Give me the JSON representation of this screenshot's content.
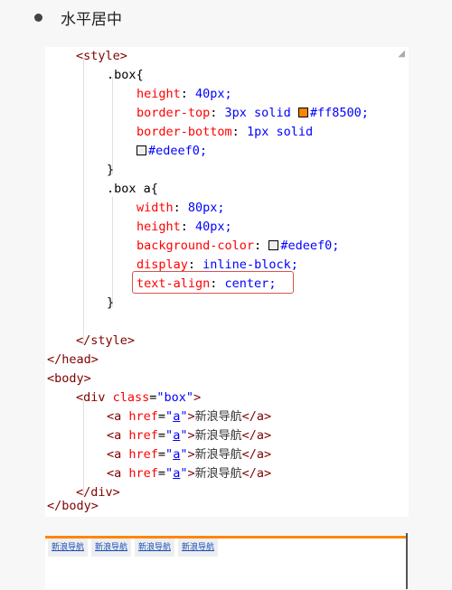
{
  "heading": {
    "text": "水平居中"
  },
  "code": {
    "l1": "<style>",
    "l2": ".box{",
    "l3_prop": "height",
    "l3_val": "40px;",
    "l4_prop": "border-top",
    "l4_val": "3px solid",
    "l4_color": "#ff8500;",
    "l5_prop": "border-bottom",
    "l5_val": "1px solid",
    "l6_color": "#edeef0;",
    "l7": "}",
    "l8": ".box a{",
    "l9_prop": "width",
    "l9_val": "80px;",
    "l10_prop": "height",
    "l10_val": "40px;",
    "l11_prop": "background-color",
    "l11_color": "#edeef0;",
    "l12_prop": "display",
    "l12_val": "inline-block;",
    "l13_prop": "text-align",
    "l13_val": "center;",
    "l14": "}",
    "l15": "</style>",
    "l16": "</head>",
    "l17": "<body>",
    "l18_open": "<div ",
    "l18_attr": "class",
    "l18_eq": "=",
    "l18_str": "\"box\"",
    "l18_close": ">",
    "link_open": "<a ",
    "link_attr": "href",
    "link_eq": "=",
    "link_str_q1": "\"",
    "link_str_a": "a",
    "link_str_q2": "\"",
    "link_gt": ">",
    "link_text": "新浪导航",
    "link_close": "</a>",
    "l23": "</div>",
    "l24": "</body>"
  },
  "preview": {
    "link_label": "新浪导航"
  },
  "colors": {
    "swatch_orange": "#ff8500",
    "swatch_grey": "#edeef0",
    "highlight": "#d9534f"
  }
}
